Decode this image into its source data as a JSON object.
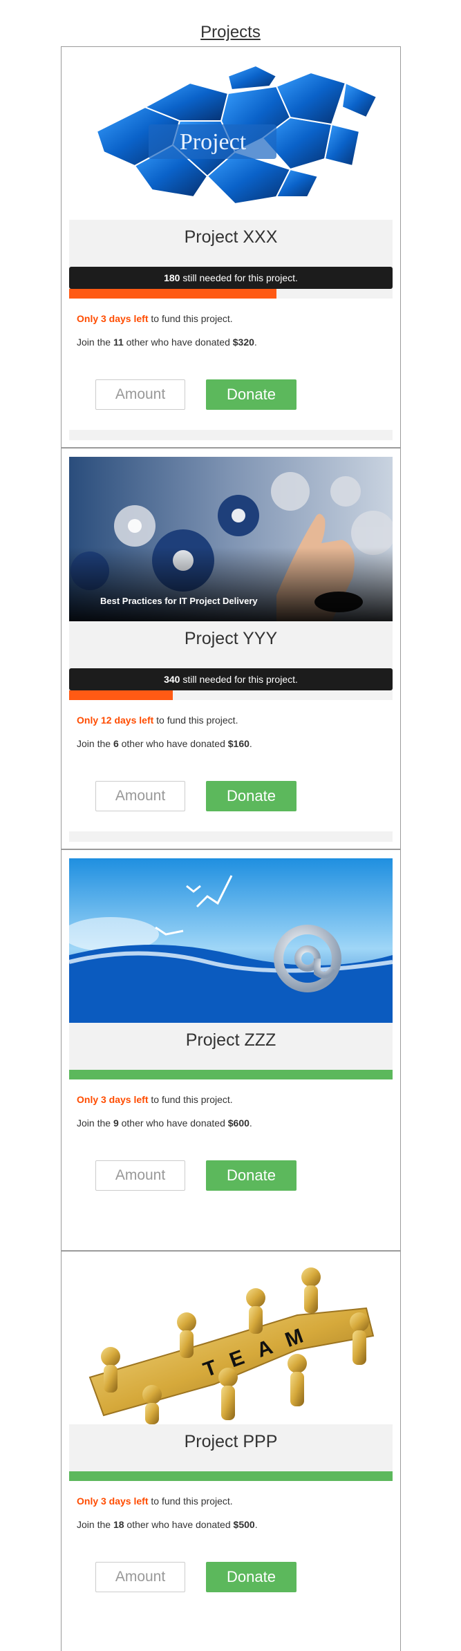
{
  "page": {
    "title": "Projects"
  },
  "projects": [
    {
      "name": "Project XXX",
      "image": "project-puzzle",
      "image_text": "Project",
      "needed_amount": "180",
      "needed_suffix": " still needed for this project.",
      "progress": 0.64,
      "progress_color": "#ff5a14",
      "days_left": "Only 3 days left",
      "days_suffix": " to fund this project.",
      "join_prefix": "Join the ",
      "donor_count": "11",
      "join_mid": " other who have donated ",
      "donated": "$320",
      "join_suffix": ".",
      "amount_placeholder": "Amount",
      "donate_label": "Donate"
    },
    {
      "name": "Project YYY",
      "image": "gears",
      "image_text": "Best Practices for IT Project Delivery",
      "needed_amount": "340",
      "needed_suffix": " still needed for this project.",
      "progress": 0.32,
      "progress_color": "#ff5a14",
      "days_left": "Only 12 days left",
      "days_suffix": " to fund this project.",
      "join_prefix": "Join the ",
      "donor_count": "6",
      "join_mid": " other who have donated ",
      "donated": "$160",
      "join_suffix": ".",
      "amount_placeholder": "Amount",
      "donate_label": "Donate"
    },
    {
      "name": "Project ZZZ",
      "image": "at-sign-ocean",
      "progress": 1.0,
      "progress_color": "#5cb85c",
      "days_left": "Only 3 days left",
      "days_suffix": " to fund this project.",
      "join_prefix": "Join the ",
      "donor_count": "9",
      "join_mid": " other who have donated ",
      "donated": "$600",
      "join_suffix": ".",
      "amount_placeholder": "Amount",
      "donate_label": "Donate"
    },
    {
      "name": "Project PPP",
      "image": "team-puzzle",
      "image_text": "TEAM",
      "progress": 1.0,
      "progress_color": "#5cb85c",
      "days_left": "Only 3 days left",
      "days_suffix": " to fund this project.",
      "join_prefix": "Join the ",
      "donor_count": "18",
      "join_mid": " other who have donated ",
      "donated": "$500",
      "join_suffix": ".",
      "amount_placeholder": "Amount",
      "donate_label": "Donate"
    }
  ]
}
